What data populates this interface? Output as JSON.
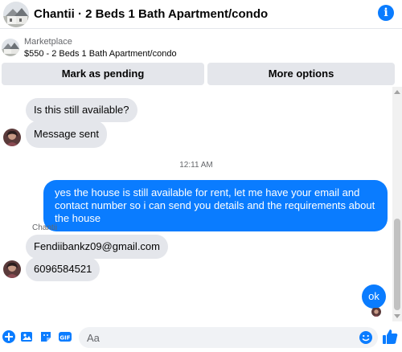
{
  "header": {
    "title": "Chantii · 2 Beds 1 Bath Apartment/condo",
    "info_glyph": "i",
    "info_icon": "info-icon"
  },
  "marketplace": {
    "label": "Marketplace",
    "listing": "$550 - 2 Beds 1 Bath Apartment/condo"
  },
  "actions": {
    "mark_pending": "Mark as pending",
    "more_options": "More options"
  },
  "conversation": {
    "messages_before": [
      {
        "text": "Is this still available?",
        "from": "them"
      },
      {
        "text": "Message sent",
        "from": "them"
      }
    ],
    "timestamp": "12:11 AM",
    "outgoing_long": "yes the house is still available for rent, let me have your email  and contact number so i can send you details and the requirements about the house",
    "sender_name": "Chantii",
    "messages_after": [
      {
        "text": "Fendiibankz09@gmail.com",
        "from": "them"
      },
      {
        "text": "6096584521",
        "from": "them"
      }
    ],
    "outgoing_short": "ok"
  },
  "composer": {
    "placeholder": "Aa"
  },
  "colors": {
    "accent": "#0a7cff",
    "incoming_bubble": "#e4e6eb",
    "button_bg": "#e4e6eb",
    "secondary_text": "#65676b"
  }
}
